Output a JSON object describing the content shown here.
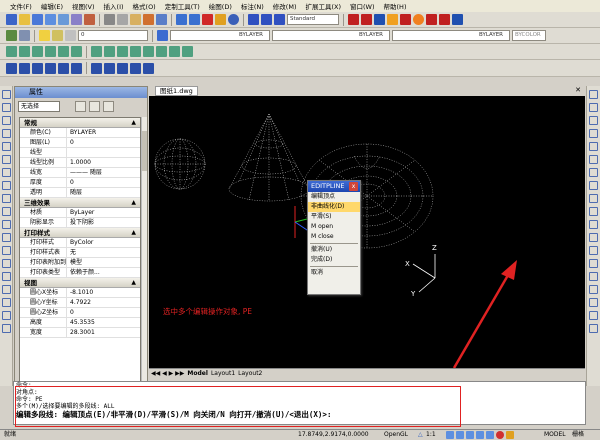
{
  "menu": [
    "文件(F)",
    "编辑(E)",
    "视图(V)",
    "插入(I)",
    "格式(O)",
    "定制工具(T)",
    "绘图(D)",
    "标注(N)",
    "修改(M)",
    "扩展工具(X)",
    "窗口(W)",
    "帮助(H)"
  ],
  "toolbar": {
    "text_style": "Standard",
    "layer_value": "0",
    "color_value": "BYLAYER",
    "linetype_value": "BYLAYER",
    "lineweight_value": "BYLAYER",
    "plotstyle_value": "BYCOLOR"
  },
  "properties": {
    "title": "属性",
    "selection": "无选择",
    "sections": [
      {
        "title": "常规",
        "rows": [
          [
            "颜色(C)",
            "BYLAYER"
          ],
          [
            "图层(L)",
            "0"
          ],
          [
            "线型",
            ""
          ],
          [
            "线型比例",
            "1.0000"
          ],
          [
            "线宽",
            "——— 随层"
          ],
          [
            "厚度",
            "0"
          ],
          [
            "透明",
            "随层"
          ]
        ]
      },
      {
        "title": "三维效果",
        "rows": [
          [
            "材质",
            "ByLayer"
          ],
          [
            "阴影显示",
            "投下阴影"
          ]
        ]
      },
      {
        "title": "打印样式",
        "rows": [
          [
            "打印样式",
            "ByColor"
          ],
          [
            "打印样式表",
            "无"
          ],
          [
            "打印表附加到",
            "模型"
          ],
          [
            "打印表类型",
            "依赖于颜..."
          ]
        ]
      },
      {
        "title": "视图",
        "rows": [
          [
            "圆心X坐标",
            "-8.1010"
          ],
          [
            "圆心Y坐标",
            "4.7922"
          ],
          [
            "圆心Z坐标",
            "0"
          ],
          [
            "高度",
            "45.3535"
          ],
          [
            "宽度",
            "28.3001"
          ]
        ]
      }
    ]
  },
  "drawing": {
    "tab": "图纸1.dwg",
    "annotation": "选中多个编辑操作对象, PE"
  },
  "editpline": {
    "title": "EDITPLINE",
    "items": [
      "编辑顶点",
      "非曲线化(D)",
      "平滑(S)",
      "M open",
      "M close",
      "撤消(U)",
      "完成(D)",
      "取消"
    ],
    "highlighted": 1
  },
  "layout_tabs": [
    "Model",
    "Layout1",
    "Layout2"
  ],
  "command": {
    "lines": [
      "命令:",
      "对角点:",
      "命令: PE",
      "多个(M)/选择要编辑的多段线: ALL"
    ],
    "prompt": "编辑多段线:  编辑顶点(E)/非平滑(D)/平滑(S)/M 向关闭/N 向打开/撤消(U)/<退出(X)>:"
  },
  "status": {
    "left": "就绪",
    "coords": "17.8749,2.9174,0.0000",
    "renderer": "OpenGL",
    "scale": "1:1",
    "model": "MODEL",
    "grid": "栅格"
  },
  "colors": {
    "highlight": "#ffd86b",
    "canvas": "#000000",
    "accent_red": "#e02222"
  }
}
